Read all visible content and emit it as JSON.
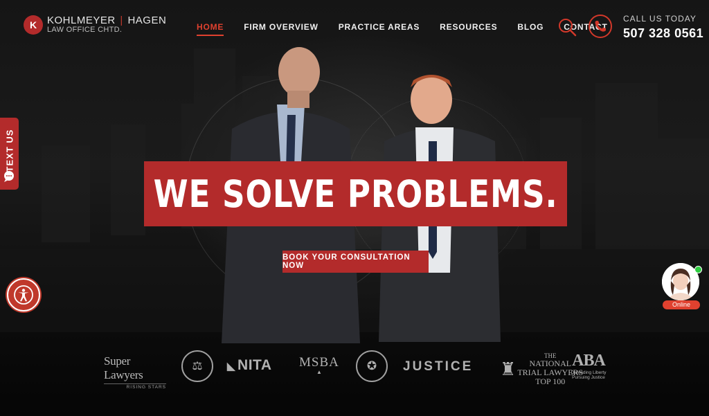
{
  "brand": {
    "mark": "K",
    "name_part1": "KOHLMEYER",
    "separator": "|",
    "name_part2": "HAGEN",
    "subtitle": "LAW OFFICE CHTD."
  },
  "nav": {
    "items": [
      {
        "label": "HOME",
        "active": true
      },
      {
        "label": "FIRM OVERVIEW",
        "active": false
      },
      {
        "label": "PRACTICE AREAS",
        "active": false
      },
      {
        "label": "RESOURCES",
        "active": false
      },
      {
        "label": "BLOG",
        "active": false
      },
      {
        "label": "CONTACT",
        "active": false
      }
    ]
  },
  "contact": {
    "call_label": "CALL US TODAY",
    "phone": "507 328 0561",
    "search_icon": "search-icon",
    "phone_icon": "phone-icon"
  },
  "hero": {
    "headline": "WE SOLVE PROBLEMS.",
    "cta_label": "BOOK YOUR CONSULTATION NOW"
  },
  "side_tab": {
    "label": "TEXT US",
    "icon": "chat-bubble-icon"
  },
  "accessibility": {
    "icon": "accessibility-icon"
  },
  "chat": {
    "status": "Online"
  },
  "badges": {
    "super_lawyers": {
      "title": "Super Lawyers",
      "subtitle": "RISING STARS"
    },
    "nita": "NITA",
    "msba": "MSBA",
    "justice": "JUSTICE",
    "ntl": {
      "line1": "THE",
      "line2": "NATIONAL",
      "line3": "TRIAL LAWYERS",
      "line4": "TOP 100"
    },
    "aba": {
      "title": "ABA",
      "line1": "Defending Liberty",
      "line2": "Pursuing Justice"
    }
  },
  "colors": {
    "accent": "#b32b2b",
    "nav_active": "#e0412f",
    "online": "#2ecc40"
  }
}
